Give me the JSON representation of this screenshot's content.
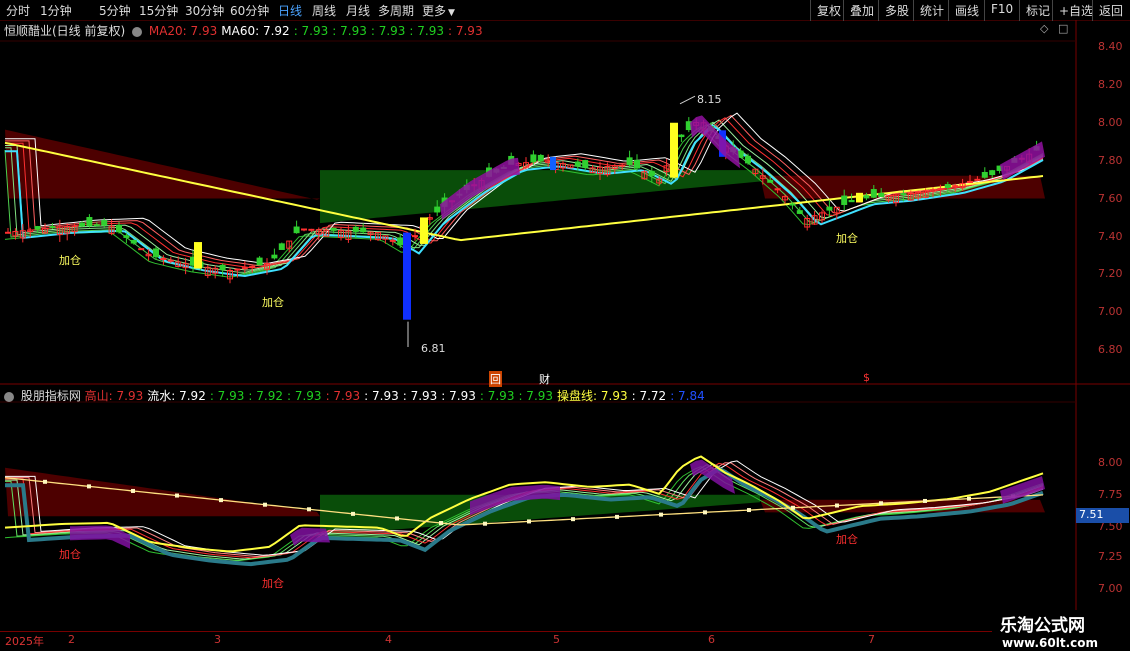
{
  "toolbar": {
    "left": [
      "分时",
      "1分钟",
      "5分钟",
      "15分钟",
      "30分钟",
      "60分钟",
      "日线",
      "周线",
      "月线",
      "多周期",
      "更多"
    ],
    "right": [
      "复权",
      "叠加",
      "多股",
      "统计",
      "画线",
      "F10",
      "标记",
      "+自选",
      "返回"
    ],
    "active": "日线"
  },
  "panel_main": {
    "title": "恒顺醋业(日线 前复权)",
    "items": [
      {
        "text": "MA20: 7.93",
        "color": "#e03030"
      },
      {
        "text": "MA60: 7.92",
        "color": "#ffffff"
      },
      {
        "text": ": 7.93",
        "color": "#20d020"
      },
      {
        "text": ": 7.93",
        "color": "#20d020"
      },
      {
        "text": ": 7.93",
        "color": "#20d020"
      },
      {
        "text": ": 7.93",
        "color": "#20d020"
      },
      {
        "text": ": 7.93",
        "color": "#e03030"
      }
    ],
    "y_ticks": [
      "8.40",
      "8.20",
      "8.00",
      "7.80",
      "7.60",
      "7.40",
      "7.20",
      "7.00",
      "6.80"
    ],
    "high_label": "8.15",
    "low_label": "6.81",
    "signals": [
      "加仓",
      "加仓",
      "加仓"
    ],
    "small_markers": [
      "回",
      "财",
      "$"
    ]
  },
  "panel_sub": {
    "title": "股朋指标网",
    "items": [
      {
        "text": "高山: 7.93",
        "color": "#e03030"
      },
      {
        "text": "流水: 7.92",
        "color": "#ffffff"
      },
      {
        "text": ": 7.93",
        "color": "#20d020"
      },
      {
        "text": ": 7.92",
        "color": "#20d020"
      },
      {
        "text": ": 7.93",
        "color": "#20d020"
      },
      {
        "text": ": 7.93",
        "color": "#e03030"
      },
      {
        "text": ": 7.93",
        "color": "#ffffff"
      },
      {
        "text": ": 7.93",
        "color": "#ffffff"
      },
      {
        "text": ": 7.93",
        "color": "#ffffff"
      },
      {
        "text": ": 7.93",
        "color": "#20d020"
      },
      {
        "text": ": 7.93",
        "color": "#20d020"
      },
      {
        "text": "操盘线: 7.93",
        "color": "#ffff40"
      },
      {
        "text": ": 7.72",
        "color": "#ffffff"
      },
      {
        "text": ": 7.84",
        "color": "#2050ff"
      }
    ],
    "y_ticks": [
      "8.00",
      "7.75",
      "7.50",
      "7.25",
      "7.00"
    ],
    "cursor_value": "7.51",
    "signals": [
      "加仓",
      "加仓",
      "加仓"
    ]
  },
  "x_axis": [
    "2025年",
    "2",
    "3",
    "4",
    "5",
    "6",
    "7"
  ],
  "watermark": {
    "line1": "乐淘公式网",
    "line2": "www.60lt.com"
  }
}
